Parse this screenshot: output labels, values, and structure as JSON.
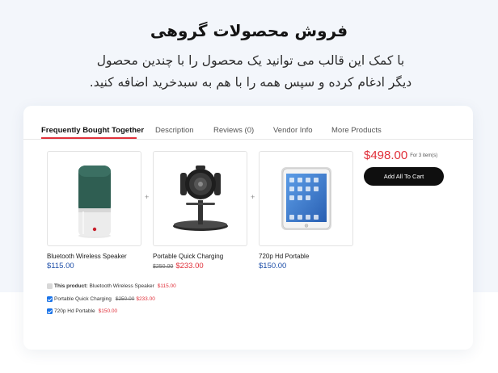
{
  "hero": {
    "title": "فروش محصولات گروهی",
    "description": "با کمک این قالب می توانید یک محصول را با چندین محصول دیگر ادغام کرده و سپس همه را با هم به سبدخرید اضافه کنید."
  },
  "tabs": [
    {
      "label": "Frequently Bought Together",
      "active": true
    },
    {
      "label": "Description",
      "active": false
    },
    {
      "label": "Reviews (0)",
      "active": false
    },
    {
      "label": "Vendor Info",
      "active": false
    },
    {
      "label": "More Products",
      "active": false
    }
  ],
  "products": [
    {
      "name": "Bluetooth Wireless Speaker",
      "price": "$115.00",
      "old_price": "",
      "icon": "speaker-image"
    },
    {
      "name": "Portable Quick Charging",
      "price": "$233.00",
      "old_price": "$250.00",
      "icon": "wireless-charger-image"
    },
    {
      "name": "720p Hd Portable",
      "price": "$150.00",
      "old_price": "",
      "icon": "tablet-image"
    }
  ],
  "plus_sign": "+",
  "summary": {
    "total": "$498.00",
    "count_label": "For 3 item(s)",
    "add_button": "Add All To Cart"
  },
  "checklist": [
    {
      "prefix": "This product:",
      "name": "Bluetooth Wireless Speaker",
      "old_price": "",
      "price": "$115.00",
      "checked": false
    },
    {
      "prefix": "",
      "name": "Portable Quick Charging",
      "old_price": "$250.00",
      "price": "$233.00",
      "checked": true
    },
    {
      "prefix": "",
      "name": "720p Hd Portable",
      "old_price": "",
      "price": "$150.00",
      "checked": true
    }
  ],
  "colors": {
    "accent_red": "#e0303a",
    "price_blue": "#1e4fa8",
    "checkbox_blue": "#1a73e8",
    "button_black": "#0f0f0f"
  }
}
